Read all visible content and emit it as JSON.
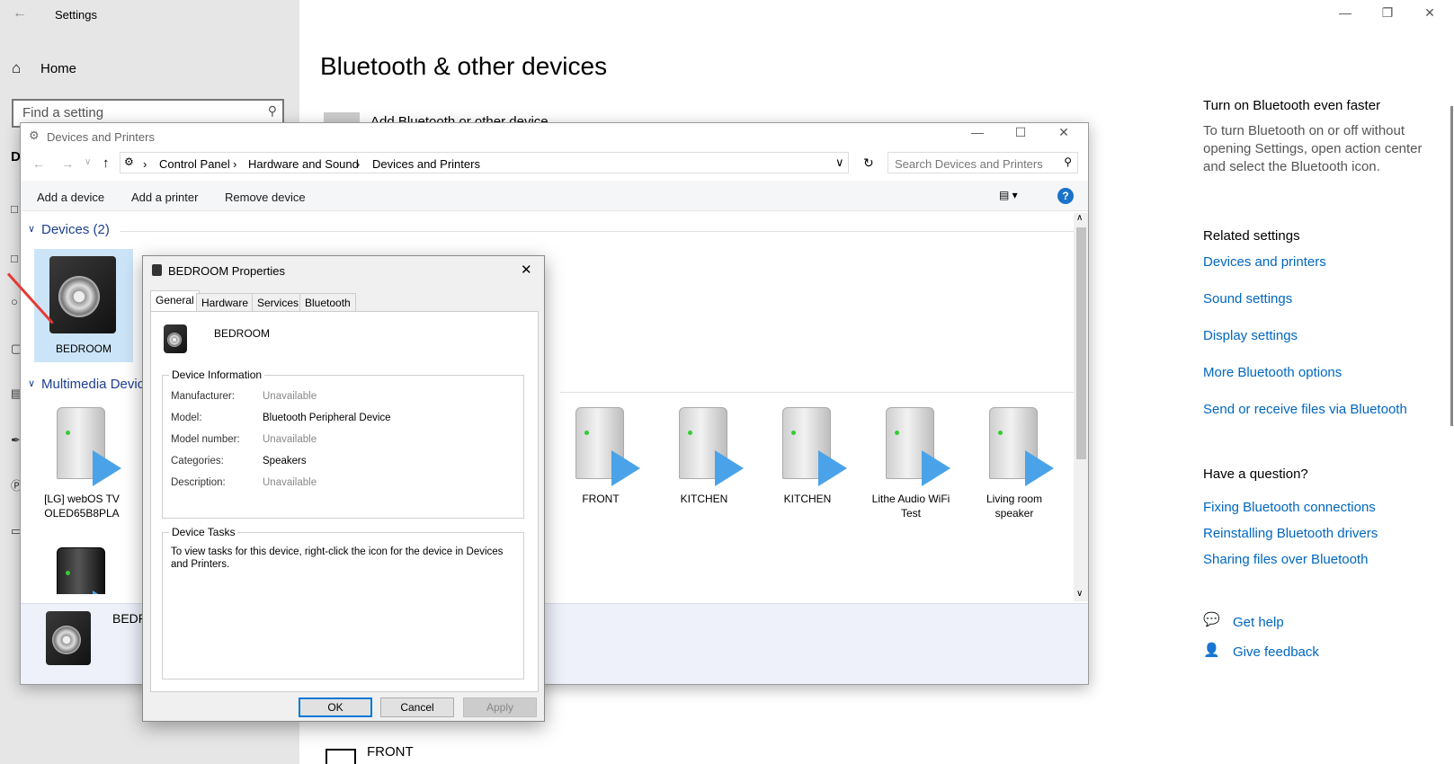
{
  "settings": {
    "title": "Settings",
    "home": "Home",
    "search_placeholder": "Find a setting",
    "partial_heading": "D",
    "page_title": "Bluetooth & other devices",
    "add_device_partial": "Add Bluetooth or other device",
    "front_device": "FRONT",
    "right": {
      "faster_heading": "Turn on Bluetooth even faster",
      "faster_text": "To turn Bluetooth on or off without opening Settings, open action center and select the Bluetooth icon.",
      "related_heading": "Related settings",
      "related_links": [
        "Devices and printers",
        "Sound settings",
        "Display settings",
        "More Bluetooth options",
        "Send or receive files via Bluetooth"
      ],
      "question_heading": "Have a question?",
      "question_links": [
        "Fixing Bluetooth connections",
        "Reinstalling Bluetooth drivers",
        "Sharing files over Bluetooth"
      ],
      "get_help": "Get help",
      "give_feedback": "Give feedback"
    }
  },
  "dp": {
    "title": "Devices and Printers",
    "breadcrumb": [
      "Control Panel",
      "Hardware and Sound",
      "Devices and Printers"
    ],
    "search_placeholder": "Search Devices and Printers",
    "commands": [
      "Add a device",
      "Add a printer",
      "Remove device"
    ],
    "group_devices": "Devices (2)",
    "group_multimedia": "Multimedia Devic",
    "selected_device": "BEDROOM",
    "devices": [
      {
        "name": "[LG] webOS TV OLED65B8PLA"
      },
      {
        "name": "FRONT"
      },
      {
        "name": "KITCHEN"
      },
      {
        "name": "KITCHEN"
      },
      {
        "name": "Lithe Audio WiFi Test"
      },
      {
        "name": "Living room speaker"
      }
    ],
    "details_name": "BEDR"
  },
  "props": {
    "title": "BEDROOM Properties",
    "tabs": [
      "General",
      "Hardware",
      "Services",
      "Bluetooth"
    ],
    "device_name": "BEDROOM",
    "info_heading": "Device Information",
    "fields": [
      {
        "label": "Manufacturer:",
        "value": "Unavailable",
        "muted": true
      },
      {
        "label": "Model:",
        "value": "Bluetooth Peripheral Device",
        "muted": false
      },
      {
        "label": "Model number:",
        "value": "Unavailable",
        "muted": true
      },
      {
        "label": "Categories:",
        "value": "Speakers",
        "muted": false
      },
      {
        "label": "Description:",
        "value": "Unavailable",
        "muted": true
      }
    ],
    "tasks_heading": "Device Tasks",
    "tasks_text": "To view tasks for this device, right-click the icon for the device in Devices and Printers.",
    "ok": "OK",
    "cancel": "Cancel",
    "apply": "Apply"
  }
}
